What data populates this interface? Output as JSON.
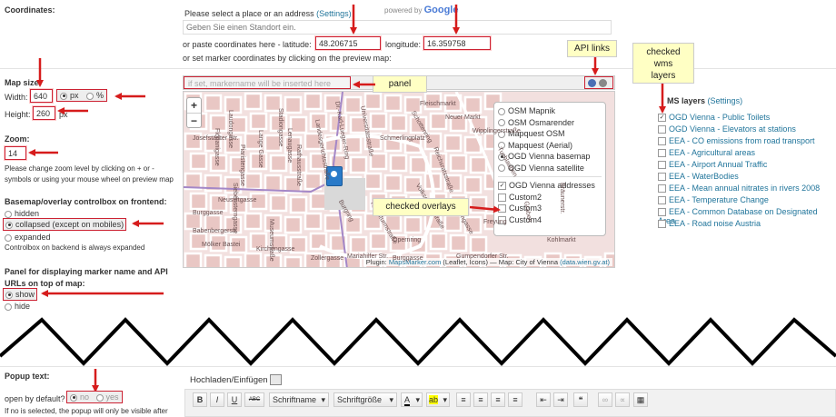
{
  "coords": {
    "label": "Coordinates:",
    "prompt": "Please select a place or an address",
    "settings_link": "(Settings)",
    "powered_by": "powered by",
    "google": "Google",
    "search_placeholder": "Geben Sie einen Standort ein.",
    "paste_label": "or paste coordinates here - latitude:",
    "latitude": "48.206715",
    "longitude_label": "longitude:",
    "longitude": "16.359758",
    "set_marker_hint": "or set marker coordinates by clicking on the preview map:"
  },
  "map_size": {
    "label": "Map size:",
    "width_label": "Width:",
    "width_value": "640",
    "unit_px": "px",
    "unit_pct": "%",
    "height_label": "Height:",
    "height_value": "260",
    "height_unit": "px"
  },
  "zoom": {
    "label": "Zoom:",
    "value": "14",
    "hint1": "Please change zoom level by clicking on + or -",
    "hint2": "symbols or using your mouse wheel on preview map"
  },
  "controlbox": {
    "label": "Basemap/overlay controlbox on frontend:",
    "options": [
      "hidden",
      "collapsed (except on mobiles)",
      "expanded"
    ],
    "selected": 1,
    "note": "Controlbox on backend is always expanded"
  },
  "panel_setting": {
    "label1": "Panel for displaying marker name and API",
    "label2": "URLs on top of map:",
    "options": [
      "show",
      "hide"
    ],
    "selected": 0
  },
  "map": {
    "panel_placeholder": "if set, markername will be inserted here",
    "zoom_in": "+",
    "zoom_out": "−",
    "basemaps": [
      "OSM Mapnik",
      "OSM Osmarender",
      "Mapquest OSM",
      "Mapquest (Aerial)",
      "OGD Vienna basemap",
      "OGD Vienna satellite"
    ],
    "basemap_selected": 4,
    "overlays": [
      "OGD Vienna addresses",
      "Custom2",
      "Custom3",
      "Custom4"
    ],
    "overlay_checked": [
      true,
      false,
      false,
      false
    ],
    "attribution_prefix": "Plugin:",
    "attribution_link1": "MapsMarker.com",
    "attribution_mid": "(Leaflet, Icons) — Map: City of Vienna",
    "attribution_link2": "(data.wien.gv.at)",
    "streets": [
      "Lange Gasse",
      "Laudongasse",
      "Josefstädter Str.",
      "Piaristengasse",
      "Florianigasse",
      "Lenaugasse",
      "Landesgerichtsstraße",
      "Universitätsstraße",
      "Dr.-Karl-Lueger-Ring",
      "Schottenring",
      "Rathausstraße",
      "Stadiongasse",
      "Schmerlingplatz",
      "Neustiftgasse",
      "Burggasse",
      "Burgring",
      "Opernring",
      "Museumstraße",
      "Volksgartenstraße",
      "Reichsratsstraße",
      "Herrengasse",
      "Freyung",
      "Wipplingerstraße",
      "Tuchlauben",
      "Graben",
      "Kohlmarkt",
      "Bräunerstr.",
      "Neuer Markt",
      "Fleischmarkt",
      "Rotenturmstraße",
      "Mölker Bastei",
      "Siebensterngasse",
      "Kirchengasse",
      "Zollergasse",
      "Mariahilfer Str.",
      "Babenbergerstr.",
      "Burggasse",
      "Gumpendorfer Str."
    ]
  },
  "callouts": {
    "panel": "panel",
    "api_links": "API links",
    "checked_wms": [
      "checked",
      "wms",
      "layers"
    ],
    "checked_overlays": "checked overlays"
  },
  "wms": {
    "title": "WMS layers",
    "title_visible": "MS layers",
    "settings": "(Settings)",
    "items": [
      {
        "label": "OGD Vienna - Public Toilets",
        "checked": true
      },
      {
        "label": "OGD Vienna - Elevators at stations",
        "checked": false
      },
      {
        "label": "EEA - CO emissions from road transport",
        "checked": false
      },
      {
        "label": "EEA - Agricultural areas",
        "checked": false
      },
      {
        "label": "EEA - Airport Annual Traffic",
        "checked": false
      },
      {
        "label": "EEA - WaterBodies",
        "checked": false
      },
      {
        "label": "EEA - Mean annual nitrates in rivers 2008",
        "checked": false
      },
      {
        "label": "EEA - Temperature Change",
        "checked": false
      },
      {
        "label": "EEA - Common Database on Designated Area",
        "checked": false
      },
      {
        "label": "EEA - Road noise Austria",
        "checked": false
      }
    ]
  },
  "popup": {
    "label": "Popup text:",
    "open_default": "open by default?",
    "no": "no",
    "yes": "yes",
    "hint": "If no is selected, the popup will only be visible after",
    "upload_label": "Hochladen/Einfügen",
    "toolbar": {
      "bold": "B",
      "italic": "I",
      "underline": "U",
      "strike": "ABC",
      "font_family": "Schriftname",
      "font_size": "Schriftgröße",
      "font_color": "A",
      "highlight": "ab",
      "quote": "❝"
    }
  },
  "colors": {
    "arrow": "#d61c1c",
    "link": "#21759b",
    "callout_bg": "#ffffc4",
    "map_bg": "#f2e0df"
  }
}
